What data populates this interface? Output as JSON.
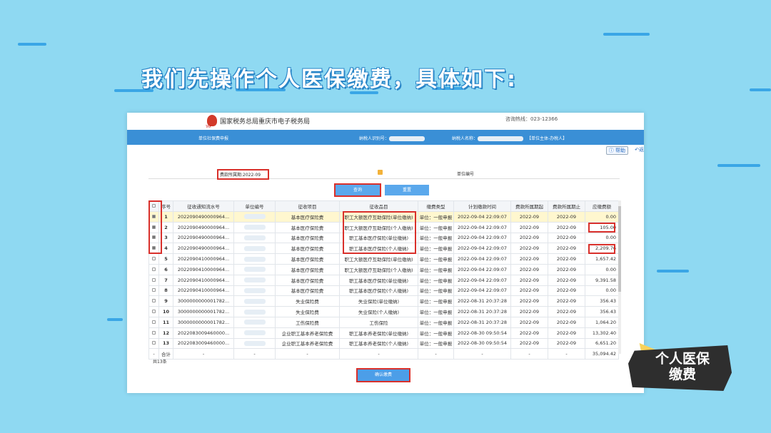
{
  "headline": "我们先操作个人医保缴费，具体如下:",
  "header": {
    "agency": "国家税务总局重庆市电子税务局",
    "emblem_text": "TAX",
    "hotline": "咨询热线：023-12366"
  },
  "bluebar": {
    "section": "单位社保费申报",
    "taxpayer_id_label": "纳税人识别号：",
    "taxpayer_name_label": "纳税人名称：",
    "role": "【单位主体-办税人】"
  },
  "helpbar": {
    "help": "帮助",
    "back": "返"
  },
  "form": {
    "period": "费款所属期:2022-09",
    "unit_no_label": "单位编号"
  },
  "buttons": {
    "query": "查询",
    "reset": "重置",
    "confirm": "确认缴费"
  },
  "table": {
    "headers": [
      "",
      "序号",
      "征收通知流水号",
      "单位编号",
      "征收项目",
      "征收品目",
      "缴费类型",
      "计划缴款时间",
      "费款所属期起",
      "费款所属期止",
      "应缴费额"
    ],
    "rows": [
      {
        "checked": true,
        "no": "1",
        "serial": "2022090490000964...",
        "item": "基本医疗保险费",
        "sub": "职工大额医疗互助保险(单位缴纳)",
        "type": "单位：一般申报",
        "time": "2022-09-04 22:09:07",
        "from": "2022-09",
        "to": "2022-09",
        "amount": "0.00"
      },
      {
        "checked": true,
        "no": "2",
        "serial": "2022090490000964...",
        "item": "基本医疗保险费",
        "sub": "职工大额医疗互助保险(个人缴纳)",
        "type": "单位：一般申报",
        "time": "2022-09-04 22:09:07",
        "from": "2022-09",
        "to": "2022-09",
        "amount": "105.00"
      },
      {
        "checked": true,
        "no": "3",
        "serial": "2022090490000964...",
        "item": "基本医疗保险费",
        "sub": "职工基本医疗保险(单位缴纳)",
        "type": "单位：一般申报",
        "time": "2022-09-04 22:09:07",
        "from": "2022-09",
        "to": "2022-09",
        "amount": "0.00"
      },
      {
        "checked": true,
        "no": "4",
        "serial": "2022090490000964...",
        "item": "基本医疗保险费",
        "sub": "职工基本医疗保险(个人缴纳)",
        "type": "单位：一般申报",
        "time": "2022-09-04 22:09:07",
        "from": "2022-09",
        "to": "2022-09",
        "amount": "2,209.76"
      },
      {
        "checked": false,
        "no": "5",
        "serial": "2022090410000964...",
        "item": "基本医疗保险费",
        "sub": "职工大额医疗互助保险(单位缴纳)",
        "type": "单位：一般申报",
        "time": "2022-09-04 22:09:07",
        "from": "2022-09",
        "to": "2022-09",
        "amount": "1,657.42"
      },
      {
        "checked": false,
        "no": "6",
        "serial": "2022090410000964...",
        "item": "基本医疗保险费",
        "sub": "职工大额医疗互助保险(个人缴纳)",
        "type": "单位：一般申报",
        "time": "2022-09-04 22:09:07",
        "from": "2022-09",
        "to": "2022-09",
        "amount": "0.00"
      },
      {
        "checked": false,
        "no": "7",
        "serial": "2022090410000964...",
        "item": "基本医疗保险费",
        "sub": "职工基本医疗保险(单位缴纳)",
        "type": "单位：一般申报",
        "time": "2022-09-04 22:09:07",
        "from": "2022-09",
        "to": "2022-09",
        "amount": "9,391.58"
      },
      {
        "checked": false,
        "no": "8",
        "serial": "2022090410000964...",
        "item": "基本医疗保险费",
        "sub": "职工基本医疗保险(个人缴纳)",
        "type": "单位：一般申报",
        "time": "2022-09-04 22:09:07",
        "from": "2022-09",
        "to": "2022-09",
        "amount": "0.00"
      },
      {
        "checked": false,
        "no": "9",
        "serial": "3000000000001782...",
        "item": "失业保险费",
        "sub": "失业保险(单位缴纳)",
        "type": "单位：一般申报",
        "time": "2022-08-31 20:37:28",
        "from": "2022-09",
        "to": "2022-09",
        "amount": "356.43"
      },
      {
        "checked": false,
        "no": "10",
        "serial": "3000000000001782...",
        "item": "失业保险费",
        "sub": "失业保险(个人缴纳)",
        "type": "单位：一般申报",
        "time": "2022-08-31 20:37:28",
        "from": "2022-09",
        "to": "2022-09",
        "amount": "356.43"
      },
      {
        "checked": false,
        "no": "11",
        "serial": "3000000000001782...",
        "item": "工伤保险费",
        "sub": "工伤保险",
        "type": "单位：一般申报",
        "time": "2022-08-31 20:37:28",
        "from": "2022-09",
        "to": "2022-09",
        "amount": "1,064.20"
      },
      {
        "checked": false,
        "no": "12",
        "serial": "2022083009460000...",
        "item": "企业职工基本养老保险费",
        "sub": "职工基本养老保险(单位缴纳)",
        "type": "单位：一般申报",
        "time": "2022-08-30 09:50:54",
        "from": "2022-09",
        "to": "2022-09",
        "amount": "13,302.40"
      },
      {
        "checked": false,
        "no": "13",
        "serial": "2022083009460000...",
        "item": "企业职工基本养老保险费",
        "sub": "职工基本养老保险(个人缴纳)",
        "type": "单位：一般申报",
        "time": "2022-08-30 09:50:54",
        "from": "2022-09",
        "to": "2022-09",
        "amount": "6,651.20"
      }
    ],
    "total_row": {
      "mark": "-",
      "label": "合计",
      "dash": "-",
      "amount": "35,094.42"
    }
  },
  "total_count": "共13条",
  "sticker": {
    "line1": "个人医保",
    "line2": "缴费"
  },
  "colors": {
    "background": "#8fd9f2",
    "bar": "#3a8fd6",
    "button": "#5aa8ec",
    "highlight": "#d9302b"
  }
}
